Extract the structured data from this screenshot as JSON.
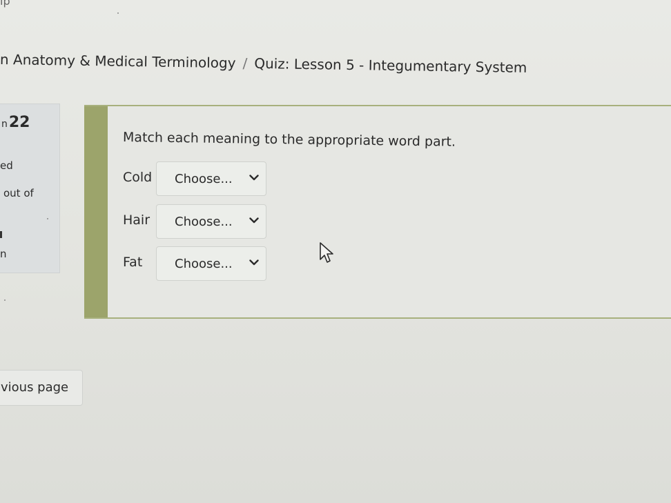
{
  "top_fragment": "ıp",
  "breadcrumb": {
    "course": "n Anatomy & Medical Terminology",
    "separator": "/",
    "page": "Quiz: Lesson 5 - Integumentary System"
  },
  "question_info": {
    "number_prefix": "n",
    "number": "22",
    "state": "ed",
    "marks": "out of",
    "flag_text": "n"
  },
  "question": {
    "prompt": "Match each meaning to the appropriate word part.",
    "rows": [
      {
        "term": "Cold",
        "selected": "Choose..."
      },
      {
        "term": "Hair",
        "selected": "Choose..."
      },
      {
        "term": "Fat",
        "selected": "Choose..."
      }
    ]
  },
  "navigation": {
    "previous_label": "vious page"
  },
  "colors": {
    "accent": "#9ca46b",
    "panel": "#dcdfe0",
    "background": "#e6e7e3"
  },
  "icons": {
    "select_arrow": "chevron-down-icon",
    "pointer": "mouse-cursor-icon"
  }
}
